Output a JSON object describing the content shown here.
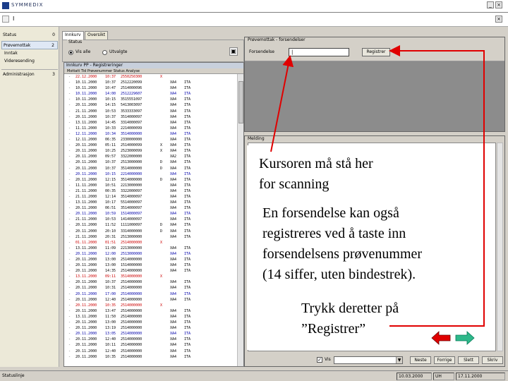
{
  "window": {
    "title": "SYMMEDIX",
    "menu_item": "I"
  },
  "sidebar": {
    "items": [
      {
        "label": "Status",
        "count": "0",
        "selected": false
      },
      {
        "label": "Prøvemottak",
        "count": "2",
        "selected": true
      },
      {
        "label": "Inntak",
        "count": "",
        "selected": false
      },
      {
        "label": "Videresending",
        "count": "",
        "selected": false
      },
      {
        "label": "Administrasjon",
        "count": "3",
        "selected": false
      }
    ]
  },
  "middle": {
    "tabs": [
      "Innkurv",
      "Oversikt"
    ],
    "status_group_label": "Status",
    "radio_all": "Vis alle",
    "radio_selected": "Utvalgte",
    "list_title": "Innkurv PP - Registreringer",
    "list_header": "Mottatt  Tid  Prøvenummer  Status  Analyse"
  },
  "rows": [
    {
      "d": "22.12.2000",
      "t": "10:37",
      "n": "2550250300",
      "f": "X",
      "c1": "",
      "c2": ""
    },
    {
      "d": "10.11.2000",
      "t": "10:37",
      "n": "2512220099",
      "f": "",
      "c1": "XA4",
      "c2": "ITA"
    },
    {
      "d": "10.11.2000",
      "t": "10:47",
      "n": "2514000096",
      "f": "",
      "c1": "XA4",
      "c2": "ITA"
    },
    {
      "d": "10.11.2000",
      "t": "14:00",
      "n": "2512229607",
      "f": "",
      "c1": "XA4",
      "c2": "ITA"
    },
    {
      "d": "10.11.2000",
      "t": "10:15",
      "n": "3515551097",
      "f": "",
      "c1": "XA4",
      "c2": "ITA"
    },
    {
      "d": "20.11.2000",
      "t": "14:15",
      "n": "5413003097",
      "f": "",
      "c1": "XA4",
      "c2": "ITA"
    },
    {
      "d": "21.11.2000",
      "t": "10:53",
      "n": "3533333097",
      "f": "",
      "c1": "XA4",
      "c2": "ITA"
    },
    {
      "d": "20.11.2000",
      "t": "10:37",
      "n": "3514000097",
      "f": "",
      "c1": "XA4",
      "c2": "ITA"
    },
    {
      "d": "13.11.2000",
      "t": "14:45",
      "n": "3314000097",
      "f": "",
      "c1": "XA4",
      "c2": "ITA"
    },
    {
      "d": "11.11.2000",
      "t": "10:33",
      "n": "2214000099",
      "f": "",
      "c1": "XA4",
      "c2": "ITA"
    },
    {
      "d": "12.11.2000",
      "t": "10:34",
      "n": "3514000000",
      "f": "",
      "c1": "XA4",
      "c2": "ITA"
    },
    {
      "d": "12.11.2000",
      "t": "06:35",
      "n": "2330000000",
      "f": "",
      "c1": "XA4",
      "c2": "ITA"
    },
    {
      "d": "20.11.2000",
      "t": "05:11",
      "n": "2514000099",
      "f": "X",
      "c1": "XA4",
      "c2": "ITA"
    },
    {
      "d": "20.11.2000",
      "t": "10:25",
      "n": "2523000099",
      "f": "X",
      "c1": "XA4",
      "c2": "ITA"
    },
    {
      "d": "20.11.2000",
      "t": "09:57",
      "n": "3322000000",
      "f": "",
      "c1": "XA2",
      "c2": "ITA"
    },
    {
      "d": "20.11.2000",
      "t": "10:37",
      "n": "2513000000",
      "f": "D",
      "c1": "XA4",
      "c2": "ITA"
    },
    {
      "d": "20.11.2000",
      "t": "10:37",
      "n": "3514000000",
      "f": "D",
      "c1": "XA4",
      "c2": "ITA"
    },
    {
      "d": "20.11.2000",
      "t": "10:15",
      "n": "2214000000",
      "f": "",
      "c1": "XA4",
      "c2": "ITA"
    },
    {
      "d": "20.11.2000",
      "t": "12:15",
      "n": "3514000000",
      "f": "D",
      "c1": "XA4",
      "c2": "ITA"
    },
    {
      "d": "11.11.2000",
      "t": "10:51",
      "n": "2213000000",
      "f": "",
      "c1": "XA4",
      "c2": "ITA"
    },
    {
      "d": "21.11.2000",
      "t": "00:35",
      "n": "3322000097",
      "f": "",
      "c1": "XA4",
      "c2": "ITA"
    },
    {
      "d": "21.11.2000",
      "t": "12:14",
      "n": "3514000097",
      "f": "",
      "c1": "XA4",
      "c2": "ITA"
    },
    {
      "d": "13.11.2000",
      "t": "10:17",
      "n": "5514000097",
      "f": "",
      "c1": "XA4",
      "c2": "ITA"
    },
    {
      "d": "20.11.2000",
      "t": "06:51",
      "n": "3514000097",
      "f": "",
      "c1": "XA4",
      "c2": "ITA"
    },
    {
      "d": "20.11.2000",
      "t": "10:59",
      "n": "1514000097",
      "f": "",
      "c1": "XA4",
      "c2": "ITA"
    },
    {
      "d": "21.11.2000",
      "t": "10:53",
      "n": "1414000097",
      "f": "",
      "c1": "XA4",
      "c2": "ITA"
    },
    {
      "d": "20.11.2000",
      "t": "11:52",
      "n": "1111000097",
      "f": "D",
      "c1": "XA4",
      "c2": "ITA"
    },
    {
      "d": "20.11.2000",
      "t": "20:10",
      "n": "3314000000",
      "f": "D",
      "c1": "XA4",
      "c2": "ITA"
    },
    {
      "d": "21.11.2000",
      "t": "20:31",
      "n": "2513000000",
      "f": "",
      "c1": "XA4",
      "c2": "ITA"
    },
    {
      "d": "01.11.2000",
      "t": "01:51",
      "n": "2514000000",
      "f": "X",
      "c1": "",
      "c2": ""
    },
    {
      "d": "13.11.2000",
      "t": "11:09",
      "n": "2213000000",
      "f": "",
      "c1": "XA4",
      "c2": "ITA"
    },
    {
      "d": "20.11.2000",
      "t": "12:00",
      "n": "2513000000",
      "f": "",
      "c1": "XA4",
      "c2": "ITA"
    },
    {
      "d": "20.11.2000",
      "t": "13:00",
      "n": "2514000000",
      "f": "",
      "c1": "XA4",
      "c2": "ITA"
    },
    {
      "d": "20.11.2000",
      "t": "13:00",
      "n": "1514000000",
      "f": "",
      "c1": "XA4",
      "c2": "ITA"
    },
    {
      "d": "20.11.2000",
      "t": "14:35",
      "n": "2514000000",
      "f": "",
      "c1": "XA4",
      "c2": "ITA"
    },
    {
      "d": "13.11.2000",
      "t": "09:11",
      "n": "3514000000",
      "f": "X",
      "c1": "",
      "c2": ""
    },
    {
      "d": "20.11.2000",
      "t": "10:37",
      "n": "2514000000",
      "f": "",
      "c1": "XA4",
      "c2": "ITA"
    },
    {
      "d": "20.11.2000",
      "t": "10:31",
      "n": "2514000000",
      "f": "",
      "c1": "XA4",
      "c2": "ITA"
    },
    {
      "d": "20.11.2000",
      "t": "17:00",
      "n": "2514000000",
      "f": "",
      "c1": "XA4",
      "c2": "ITA"
    },
    {
      "d": "20.11.2000",
      "t": "12:40",
      "n": "2514000000",
      "f": "",
      "c1": "XA4",
      "c2": "ITA"
    },
    {
      "d": "20.11.2000",
      "t": "10:35",
      "n": "2514000000",
      "f": "X",
      "c1": "",
      "c2": ""
    },
    {
      "d": "20.11.2000",
      "t": "13:47",
      "n": "2514000000",
      "f": "",
      "c1": "XA4",
      "c2": "ITA"
    },
    {
      "d": "13.11.2000",
      "t": "11:50",
      "n": "2514000000",
      "f": "",
      "c1": "XA4",
      "c2": "ITA"
    },
    {
      "d": "20.11.2000",
      "t": "13:00",
      "n": "2514000000",
      "f": "",
      "c1": "XA4",
      "c2": "ITA"
    },
    {
      "d": "20.11.2000",
      "t": "13:19",
      "n": "2514000000",
      "f": "",
      "c1": "XA4",
      "c2": "ITA"
    },
    {
      "d": "20.11.2000",
      "t": "13:05",
      "n": "2514000000",
      "f": "",
      "c1": "XA4",
      "c2": "ITA"
    },
    {
      "d": "20.11.2000",
      "t": "12:40",
      "n": "2514000000",
      "f": "",
      "c1": "XA4",
      "c2": "ITA"
    },
    {
      "d": "20.11.2000",
      "t": "10:11",
      "n": "2514000000",
      "f": "",
      "c1": "XA4",
      "c2": "ITA"
    },
    {
      "d": "20.11.2000",
      "t": "12:40",
      "n": "2514000000",
      "f": "",
      "c1": "XA4",
      "c2": "ITA"
    },
    {
      "d": "20.11.2000",
      "t": "10:35",
      "n": "2514000000",
      "f": "",
      "c1": "XA4",
      "c2": "ITA"
    }
  ],
  "right_panel": {
    "title": "Prøvemottak - forsendelser",
    "field_label": "Forsendelse",
    "field_value": "|",
    "register_button": "Registrer",
    "lower_title": "Melding",
    "checkbox_label": "Vis",
    "btn_next": "Neste",
    "btn_prev": "Forrige",
    "btn_delete": "Slett",
    "btn_print": "Skriv"
  },
  "statusbar": {
    "text": "Statuslinje",
    "cell1": "10.03.2000",
    "cell2": "UH",
    "cell3": "17.11.2000"
  },
  "annotations": {
    "cursor_line1": "Kursoren må stå her",
    "cursor_line2": "for scanning",
    "manual_line1": "En forsendelse kan også",
    "manual_line2": "registreres ved å taste inn",
    "manual_line3": "forsendelsens prøvenummer",
    "manual_line4": "(14 siffer, uten bindestrek).",
    "press_line1": "Trykk deretter på",
    "press_line2": "”Registrer”"
  },
  "colors": {
    "arrow": "#e00000",
    "nav_prev": "#e00000",
    "nav_next": "#2eb88a"
  },
  "icons": {
    "prev_nav": "arrow-left-icon",
    "next_nav": "arrow-right-icon"
  }
}
